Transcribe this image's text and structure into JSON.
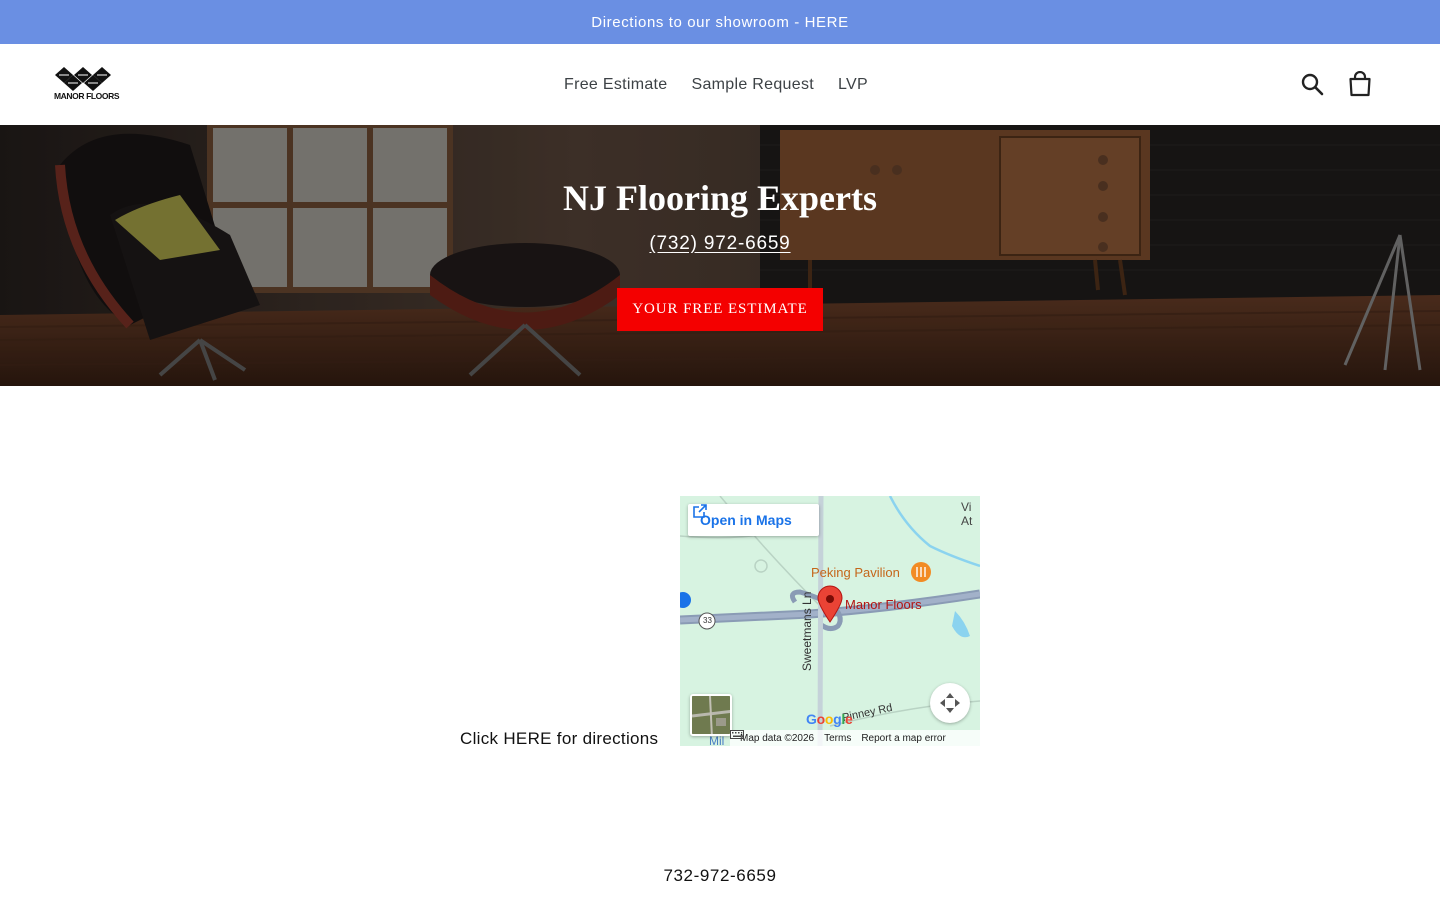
{
  "announcement": {
    "text": "Directions to our showroom - HERE"
  },
  "brand": {
    "logo_text": "MANOR FLOORS"
  },
  "nav": {
    "items": [
      {
        "label": "Free Estimate"
      },
      {
        "label": "Sample Request"
      },
      {
        "label": "LVP"
      }
    ]
  },
  "header_icons": {
    "search": "search-icon",
    "cart": "cart-icon"
  },
  "hero": {
    "title": "NJ Flooring Experts",
    "phone": "(732) 972-6659",
    "button_label": "YOUR FREE ESTIMATE",
    "button_color": "#f40000"
  },
  "directions_text": "Click HERE for directions",
  "map": {
    "open_in_maps": "Open in Maps",
    "labels": {
      "restaurant": "Peking Pavilion",
      "business": "Manor Floors",
      "street": "Sweetmans Ln",
      "road": "Pinney Rd",
      "route": "33",
      "corner_top": "Vi",
      "corner_top2": "At",
      "bottom_fragment": "Mil"
    },
    "footer": {
      "keyboard": "keyboard-icon",
      "map_data": "Map data ©2026",
      "terms": "Terms",
      "report": "Report a map error"
    },
    "google": "Google"
  },
  "bottom_phone": "732-972-6659",
  "colors": {
    "announcement_bg": "#6a8fe3",
    "map_bg": "#d7f3e1",
    "road": "#8a9bb5",
    "pin": "#ea4335"
  }
}
